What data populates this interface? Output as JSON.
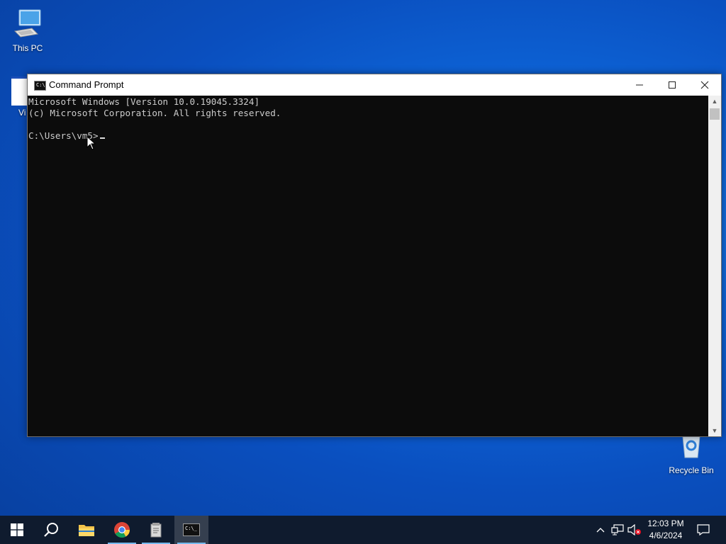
{
  "desktop": {
    "icons": [
      {
        "label": "This PC",
        "icon": "this-pc-icon"
      },
      {
        "label": "Vi",
        "icon": "app-shortcut-icon"
      },
      {
        "label": "Recycle Bin",
        "icon": "recycle-bin-icon"
      }
    ]
  },
  "window": {
    "title": "Command Prompt",
    "icon": "cmd-icon",
    "controls": {
      "minimize": "minimize-icon",
      "maximize": "maximize-icon",
      "close": "close-icon"
    }
  },
  "console": {
    "lines": [
      "Microsoft Windows [Version 10.0.19045.3324]",
      "(c) Microsoft Corporation. All rights reserved.",
      "",
      "C:\\Users\\vm5>"
    ]
  },
  "taskbar": {
    "items": [
      {
        "name": "start",
        "icon": "windows-logo-icon"
      },
      {
        "name": "search",
        "icon": "search-icon"
      },
      {
        "name": "file-explorer",
        "icon": "folder-icon"
      },
      {
        "name": "chrome",
        "icon": "chrome-icon"
      },
      {
        "name": "notepad-app",
        "icon": "app-icon"
      },
      {
        "name": "command-prompt",
        "icon": "cmd-icon",
        "active": true
      }
    ],
    "tray": {
      "icons": [
        "chevron-up-icon",
        "network-icon",
        "volume-muted-icon"
      ],
      "time": "12:03 PM",
      "date": "4/6/2024",
      "notification_icon": "notification-icon"
    }
  },
  "colors": {
    "desktop_blue": "#0a4fbf",
    "console_bg": "#0c0c0c",
    "console_text": "#cccccc",
    "taskbar_bg": "#0f1b2e"
  }
}
